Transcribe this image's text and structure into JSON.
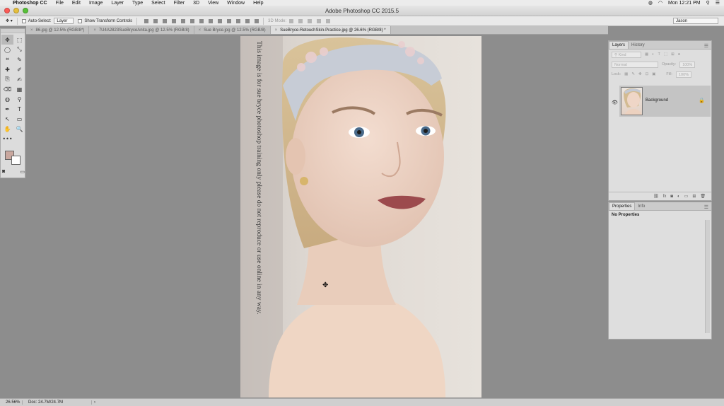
{
  "menubar": {
    "apple": "",
    "app_name": "Photoshop CC",
    "items": [
      "File",
      "Edit",
      "Image",
      "Layer",
      "Type",
      "Select",
      "Filter",
      "3D",
      "View",
      "Window",
      "Help"
    ],
    "clock": "Mon 12:21 PM"
  },
  "window": {
    "title": "Adobe Photoshop CC 2015.5",
    "light_colors": [
      "#fc5b57",
      "#e5bf3c",
      "#57c038"
    ]
  },
  "options_bar": {
    "auto_select_label": "Auto-Select:",
    "auto_select_target": "Layer",
    "show_transform_label": "Show Transform Controls",
    "mode_3d_label": "3D Mode:",
    "workspace": "Jason"
  },
  "tabs": [
    {
      "label": "86.jpg @ 12.5% (RGB/8*)",
      "close": "×"
    },
    {
      "label": "7U4A2823SueBryceAnita.jpg @ 12.5% (RGB/8)",
      "close": "×"
    },
    {
      "label": "Sue Bryce.jpg @ 12.5% (RGB/8)",
      "close": "×"
    },
    {
      "label": "SueBryce-RetouchSkin-Practice.jpg @ 26.6% (RGB/8) *",
      "close": "×"
    }
  ],
  "tools": {
    "icons": [
      "✥",
      "⬚",
      "◯",
      "⤡",
      "⌗",
      "✎",
      "✚",
      "✐",
      "⎘",
      "✍",
      "⌫",
      "▦",
      "◍",
      "⚲",
      "✒",
      "T",
      "↖",
      "▭",
      "✋",
      "🔍",
      "•••",
      ""
    ],
    "foreground_color": "#c9a79e",
    "background_color": "#ffffff"
  },
  "canvas": {
    "watermark": "This image is for sue bryce photoshop training only please do not reproduce or use online in any way.",
    "cursor": "✥"
  },
  "layers_panel": {
    "tab_layers": "Layers",
    "tab_history": "History",
    "menu_icon": "☰",
    "kind_label": "Kind",
    "blend_mode": "Normal",
    "opacity_label": "Opacity:",
    "opacity_value": "100%",
    "lock_label": "Lock:",
    "fill_label": "Fill:",
    "fill_value": "100%",
    "layer_name": "Background",
    "eye_icon": "👁",
    "lock_icon": "🔒",
    "actions": [
      "⛓",
      "fx",
      "◙",
      "◐",
      "▭",
      "⊞",
      "🗑"
    ]
  },
  "properties_panel": {
    "tab_properties": "Properties",
    "tab_info": "Info",
    "empty_text": "No Properties"
  },
  "status_bar": {
    "zoom": "26.56%",
    "doc_info": "Doc: 24.7M/24.7M",
    "arrow": "›"
  }
}
